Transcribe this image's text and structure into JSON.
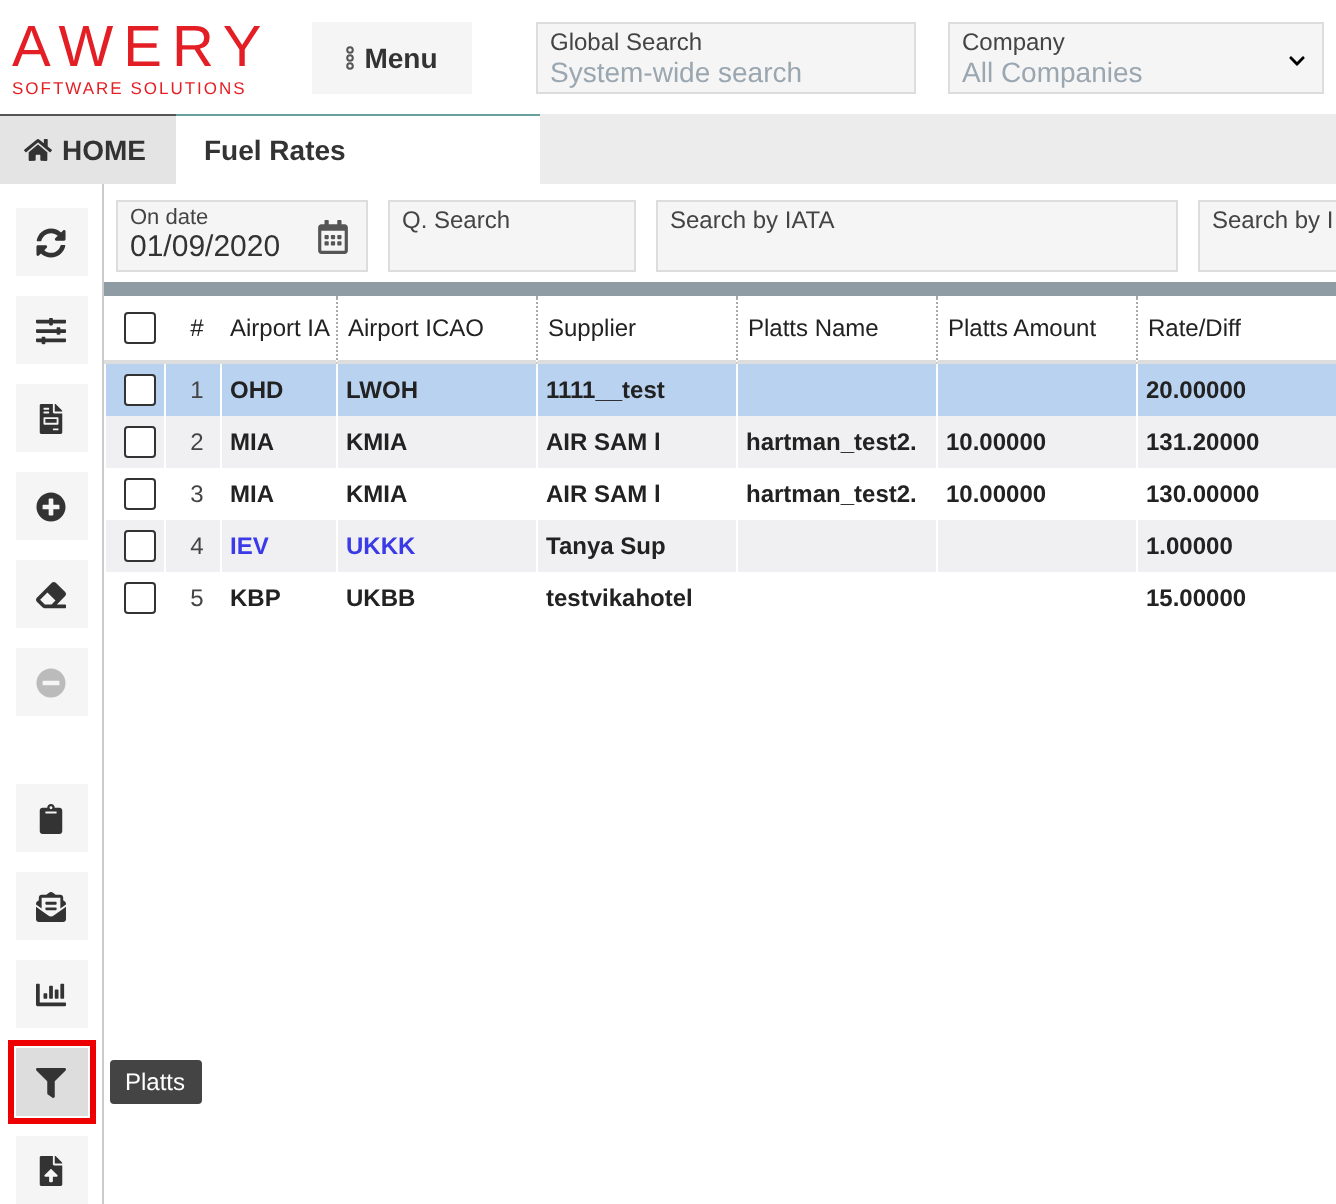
{
  "header": {
    "logo": "AWERY",
    "logo_subtitle": "SOFTWARE SOLUTIONS",
    "menu_button": "Menu",
    "global_search": {
      "label": "Global Search",
      "placeholder": "System-wide search"
    },
    "company": {
      "label": "Company",
      "value": "All Companies"
    }
  },
  "tabs": [
    {
      "label": "HOME",
      "selected": false
    },
    {
      "label": "Fuel Rates",
      "selected": true
    }
  ],
  "sidebar": {
    "items": [
      {
        "disabled": false,
        "highlighted": false
      },
      {
        "disabled": false,
        "highlighted": false
      },
      {
        "disabled": false,
        "highlighted": false
      },
      {
        "disabled": false,
        "highlighted": false
      },
      {
        "disabled": false,
        "highlighted": false
      },
      {
        "disabled": true,
        "highlighted": false
      },
      {
        "disabled": false,
        "highlighted": false
      },
      {
        "disabled": false,
        "highlighted": false
      },
      {
        "disabled": false,
        "highlighted": false
      },
      {
        "disabled": false,
        "highlighted": true,
        "tooltip": "Platts"
      },
      {
        "disabled": false,
        "highlighted": false
      }
    ]
  },
  "filters": [
    {
      "label": "On date",
      "value": "01/09/2020",
      "kind": "date"
    },
    {
      "label": "Q. Search",
      "kind": "text"
    },
    {
      "label": "Search by IATA",
      "kind": "text"
    },
    {
      "label": "Search by I",
      "kind": "text"
    }
  ],
  "table": {
    "header_checked": false,
    "columns": [
      "#",
      "Airport IA",
      "Airport ICAO",
      "Supplier",
      "Platts Name",
      "Platts Amount",
      "Rate/Diff"
    ],
    "rows": [
      {
        "selected": true,
        "checked": false,
        "linked": false,
        "cells": [
          "1",
          "OHD",
          "LWOH",
          "1111__test",
          "",
          "",
          "20.00000"
        ]
      },
      {
        "selected": false,
        "checked": false,
        "linked": false,
        "cells": [
          "2",
          "MIA",
          "KMIA",
          "AIR SAM l",
          "hartman_test2.",
          "10.00000",
          "131.20000"
        ]
      },
      {
        "selected": false,
        "checked": false,
        "linked": false,
        "cells": [
          "3",
          "MIA",
          "KMIA",
          "AIR SAM l",
          "hartman_test2.",
          "10.00000",
          "130.00000"
        ]
      },
      {
        "selected": false,
        "checked": false,
        "linked": true,
        "cells": [
          "4",
          "IEV",
          "UKKK",
          "Tanya Sup",
          "",
          "",
          "1.00000"
        ]
      },
      {
        "selected": false,
        "checked": false,
        "linked": false,
        "cells": [
          "5",
          "KBP",
          "UKBB",
          "testvikahotel",
          "",
          "",
          "15.00000"
        ]
      }
    ]
  }
}
